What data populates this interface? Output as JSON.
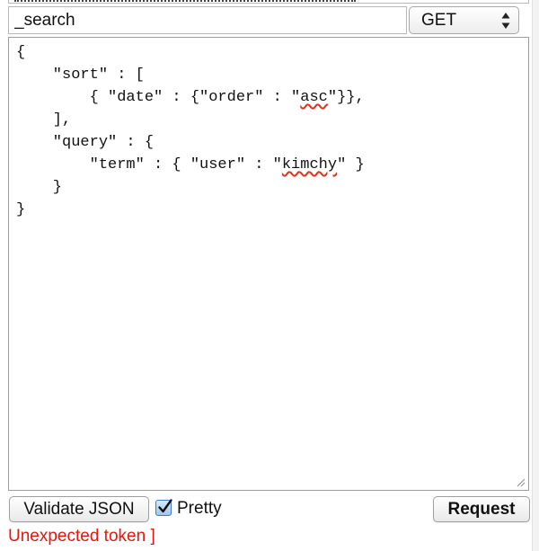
{
  "request": {
    "path_value": "_search",
    "method": "GET",
    "body_lines": [
      "{",
      "    \"sort\" : [",
      "        { \"date\" : {\"order\" : \"asc\"}},",
      "    ],",
      "    \"query\" : {",
      "        \"term\" : { \"user\" : \"kimchy\" }",
      "    }",
      "}"
    ],
    "spellchecked_words": [
      "asc",
      "kimchy"
    ]
  },
  "controls": {
    "validate_label": "Validate JSON",
    "pretty_label": "Pretty",
    "pretty_checked": true,
    "request_label": "Request"
  },
  "status": {
    "error_message": "Unexpected token ]",
    "error_color": "#e3170d"
  },
  "icons": {
    "select_arrows": "up-down-arrows-icon",
    "checkmark": "checkmark-icon",
    "resize": "resize-grip-icon"
  },
  "colors": {
    "spellcheck_underline": "#e0321e",
    "checkbox_accent": "#3d7fd6"
  }
}
